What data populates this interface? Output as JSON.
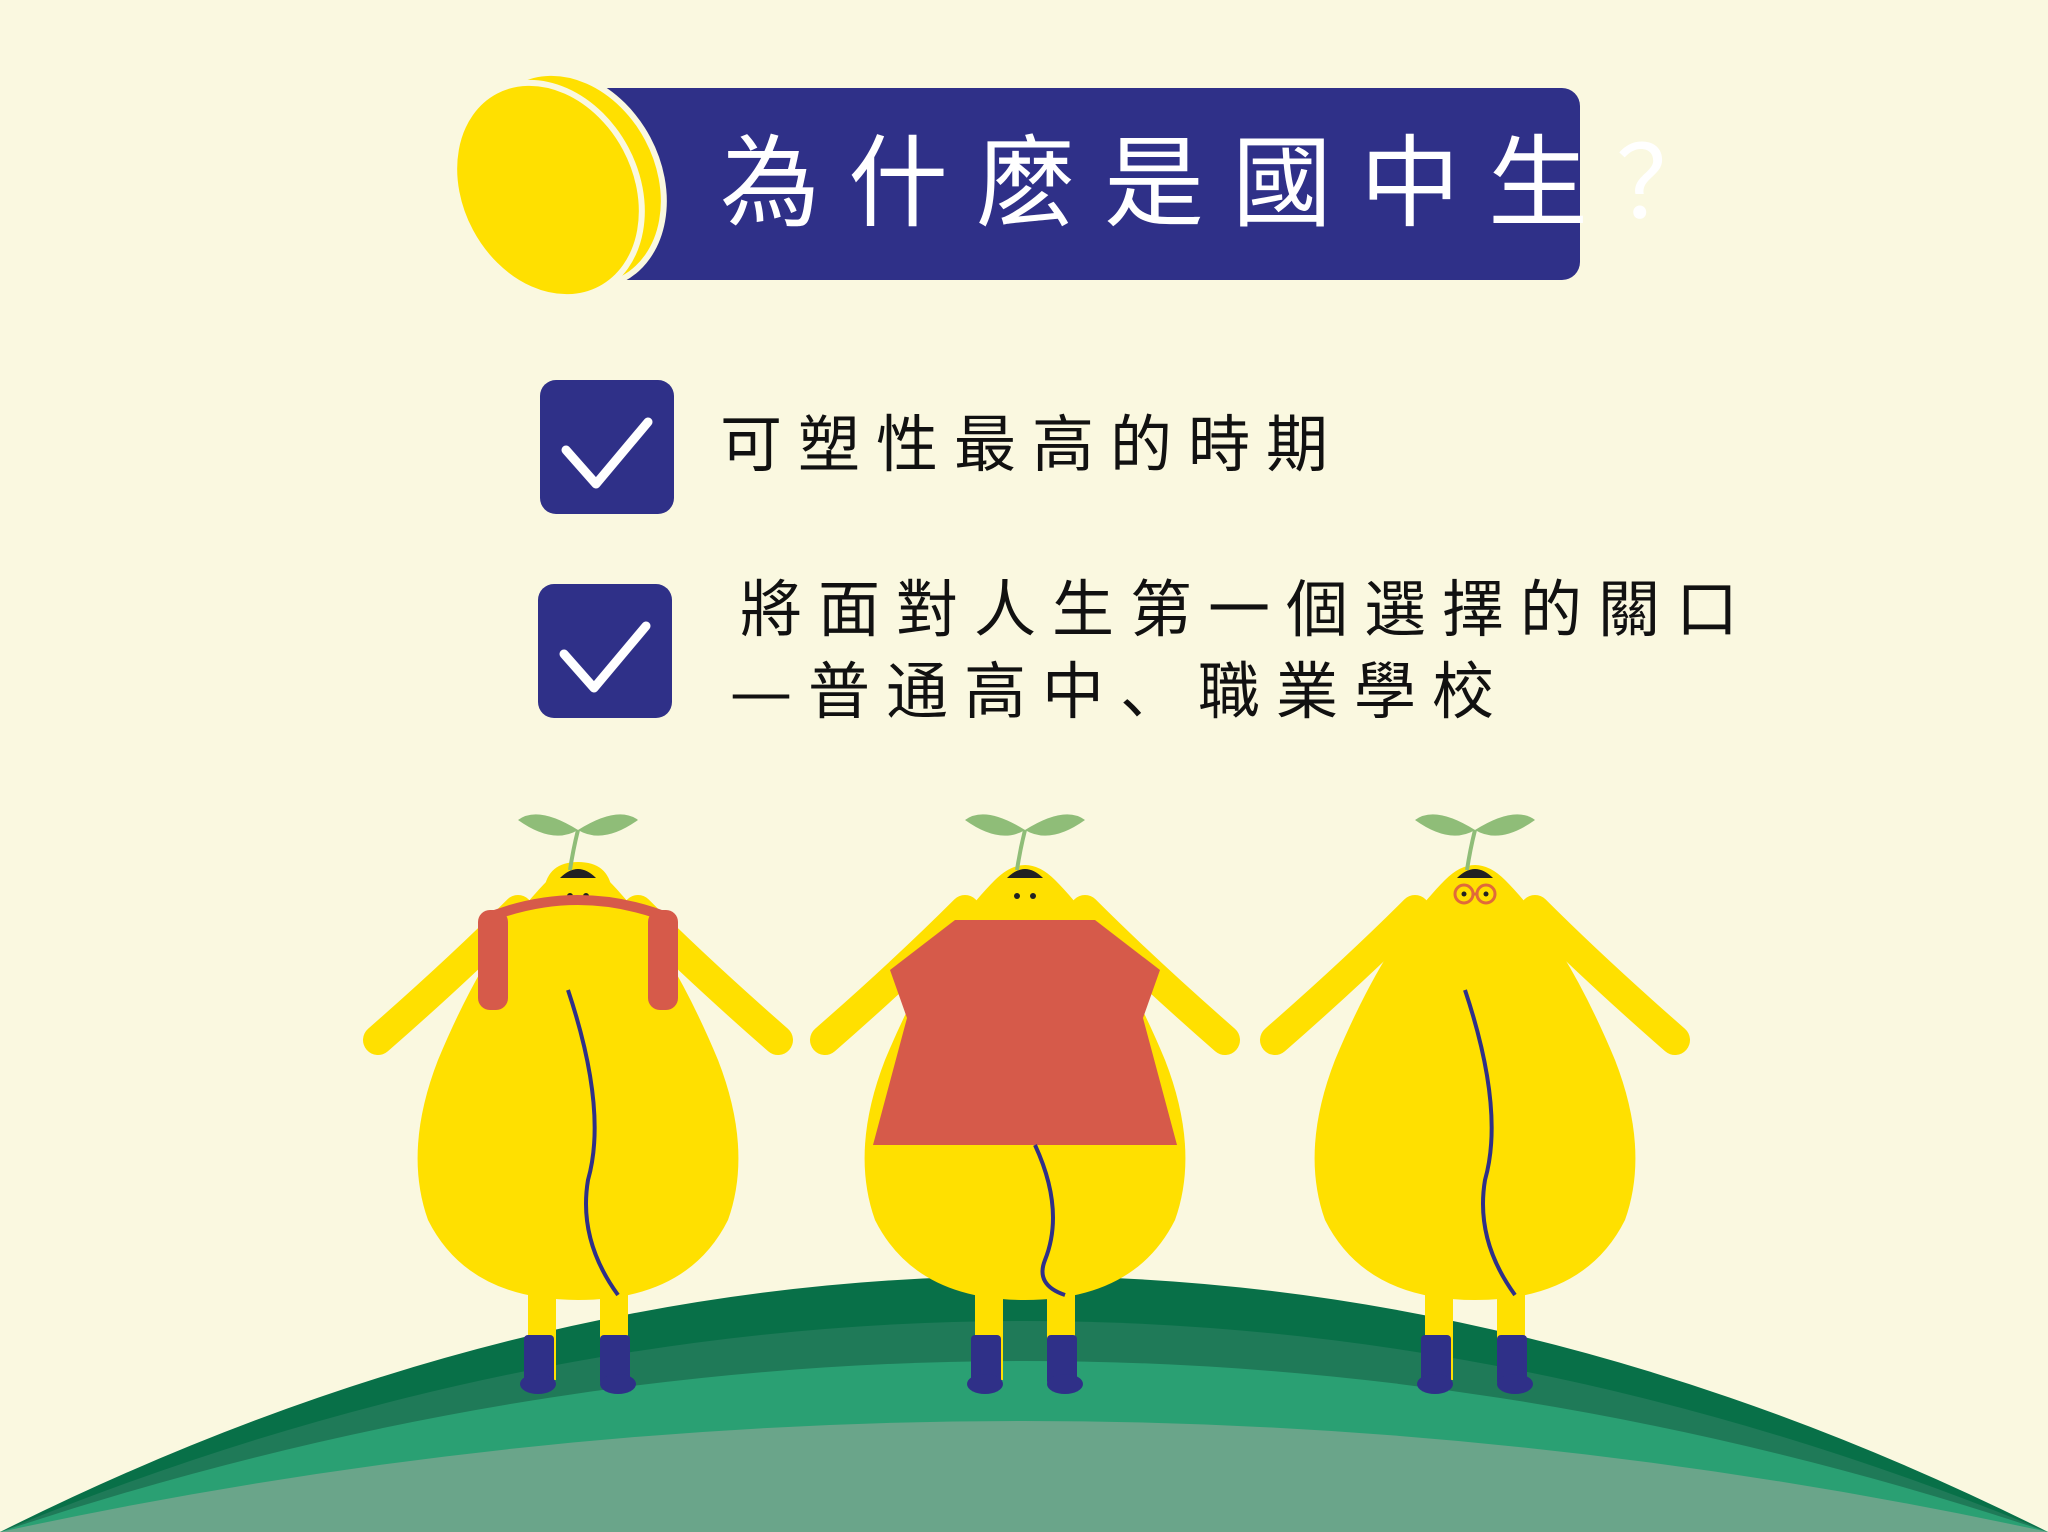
{
  "title": "為什麽是國中生？",
  "items": [
    {
      "line1": "可塑性最高的時期",
      "line2": ""
    },
    {
      "line1": "將面對人生第一個選擇的關口",
      "line2": "—普通高中、職業學校"
    }
  ],
  "colors": {
    "background": "#faf8e0",
    "navy": "#2f3088",
    "yellow": "#ffe000",
    "red": "#d65a4a",
    "leaf": "#8fbd78",
    "hill_dark": "#087048",
    "hill_mid": "#2aa073",
    "hill_light": "#6aa58a"
  },
  "icons": [
    "seed-logo-icon",
    "checkmark-icon",
    "leaf-sprout-icon"
  ]
}
